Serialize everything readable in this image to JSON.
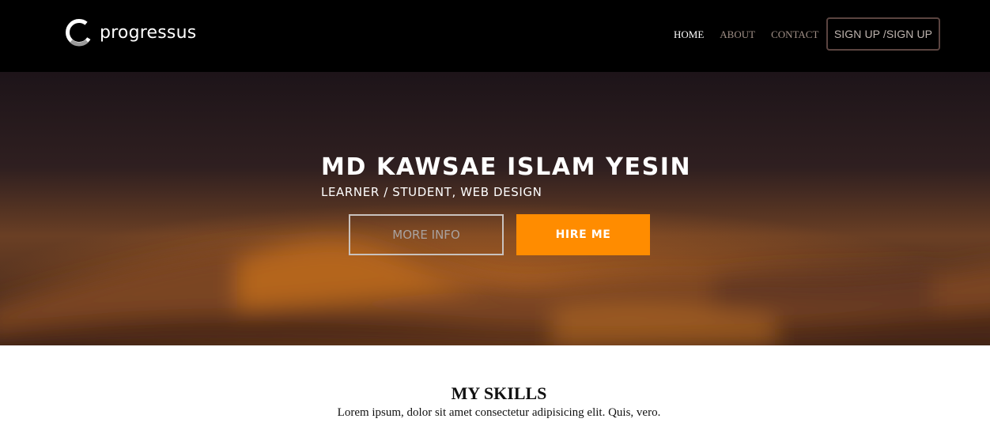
{
  "brand": {
    "name": "progressus",
    "logo_icon": "ring-logo-icon"
  },
  "nav": {
    "items": [
      {
        "label": "HOME",
        "active": true
      },
      {
        "label": "ABOUT",
        "active": false
      },
      {
        "label": "CONTACT",
        "active": false
      }
    ],
    "signup_label": "SIGN UP /SIGN UP"
  },
  "hero": {
    "title": "MD KAWSAE ISLAM YESIN",
    "subtitle": "LEARNER / STUDENT, WEB DESIGN",
    "more_info_label": "MORE INFO",
    "hire_label": "HIRE ME"
  },
  "skills": {
    "title": "MY SKILLS",
    "text": "Lorem ipsum, dolor sit amet consectetur adipisicing elit. Quis, vero."
  },
  "colors": {
    "navbar_bg": "#000000",
    "accent": "#ff8c00",
    "nav_link": "#a08f86",
    "nav_active": "#ffffff"
  }
}
